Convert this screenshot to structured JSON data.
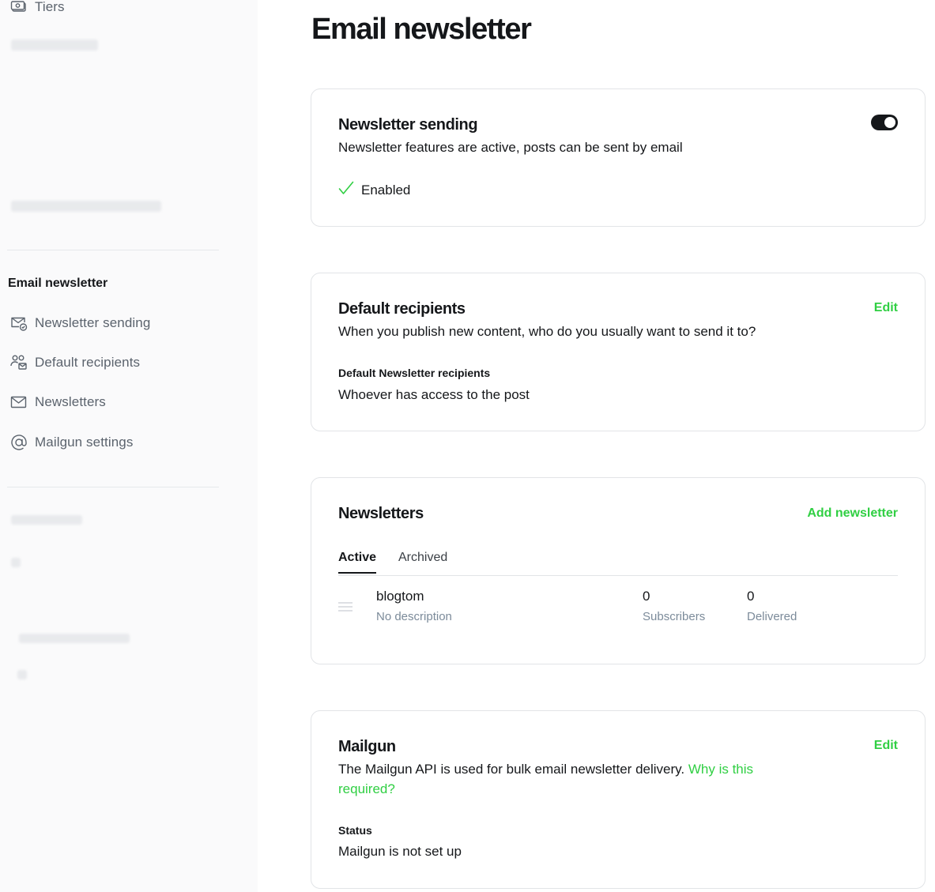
{
  "sidebar": {
    "top_item": {
      "label": "Tiers",
      "icon": "money-icon"
    },
    "section_title": "Email newsletter",
    "items": [
      {
        "label": "Newsletter sending",
        "icon": "mail-check-icon"
      },
      {
        "label": "Default recipients",
        "icon": "users-mail-icon"
      },
      {
        "label": "Newsletters",
        "icon": "mail-icon"
      },
      {
        "label": "Mailgun settings",
        "icon": "at-sign-icon"
      }
    ]
  },
  "page": {
    "title": "Email newsletter"
  },
  "newsletter_sending": {
    "title": "Newsletter sending",
    "description": "Newsletter features are active, posts can be sent by email",
    "status": "Enabled",
    "toggle_on": true
  },
  "default_recipients": {
    "title": "Default recipients",
    "action": "Edit",
    "description": "When you publish new content, who do you usually want to send it to?",
    "field_label": "Default Newsletter recipients",
    "field_value": "Whoever has access to the post"
  },
  "newsletters": {
    "title": "Newsletters",
    "action": "Add newsletter",
    "tabs": [
      "Active",
      "Archived"
    ],
    "rows": [
      {
        "name": "blogtom",
        "description": "No description",
        "subscribers": "0",
        "subscribers_label": "Subscribers",
        "delivered": "0",
        "delivered_label": "Delivered"
      }
    ]
  },
  "mailgun": {
    "title": "Mailgun",
    "action": "Edit",
    "description": "The Mailgun API is used for bulk email newsletter delivery.",
    "link": "Why is this required?",
    "status_label": "Status",
    "status_value": "Mailgun is not set up"
  },
  "colors": {
    "accent": "#30cf43",
    "text": "#15171a",
    "muted": "#5b636d"
  }
}
